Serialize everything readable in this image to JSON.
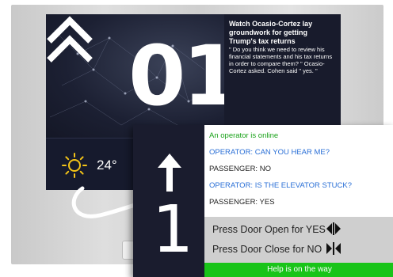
{
  "main_display": {
    "floor_number": "01",
    "direction_icon": "double-chevron-up-icon",
    "news": {
      "headline": "Watch Ocasio-Cortez lay groundwork for getting Trump's tax returns",
      "body": "\" Do you think we need to review his financial statements and his tax returns in order to compare them? \" Ocasio-Cortez asked. Cohen said \" yes. \""
    },
    "weather": {
      "icon": "sun-icon",
      "temperature": "24°"
    }
  },
  "overlay": {
    "direction_icon": "arrow-up-icon",
    "floor_number": "1",
    "chat": [
      {
        "text": "An operator is online",
        "role": "system",
        "color": "#1aa21a"
      },
      {
        "text": "OPERATOR: CAN YOU HEAR ME?",
        "role": "operator",
        "color": "#2a6fd6"
      },
      {
        "text": "PASSENGER: NO",
        "role": "passenger",
        "color": "#222222"
      },
      {
        "text": "OPERATOR: IS THE ELEVATOR STUCK?",
        "role": "operator",
        "color": "#2a6fd6"
      },
      {
        "text": "PASSENGER: YES",
        "role": "passenger",
        "color": "#222222"
      }
    ],
    "prompts": {
      "yes_label": "Press Door Open for YES",
      "yes_icon": "door-open-icon",
      "no_label": "Press Door Close for NO",
      "no_icon": "door-close-icon"
    },
    "status": "Help is on the way"
  },
  "colors": {
    "status_green": "#19c419",
    "operator_blue": "#2a6fd6",
    "online_green": "#1aa21a",
    "screen_dark": "#1a1c2e"
  }
}
